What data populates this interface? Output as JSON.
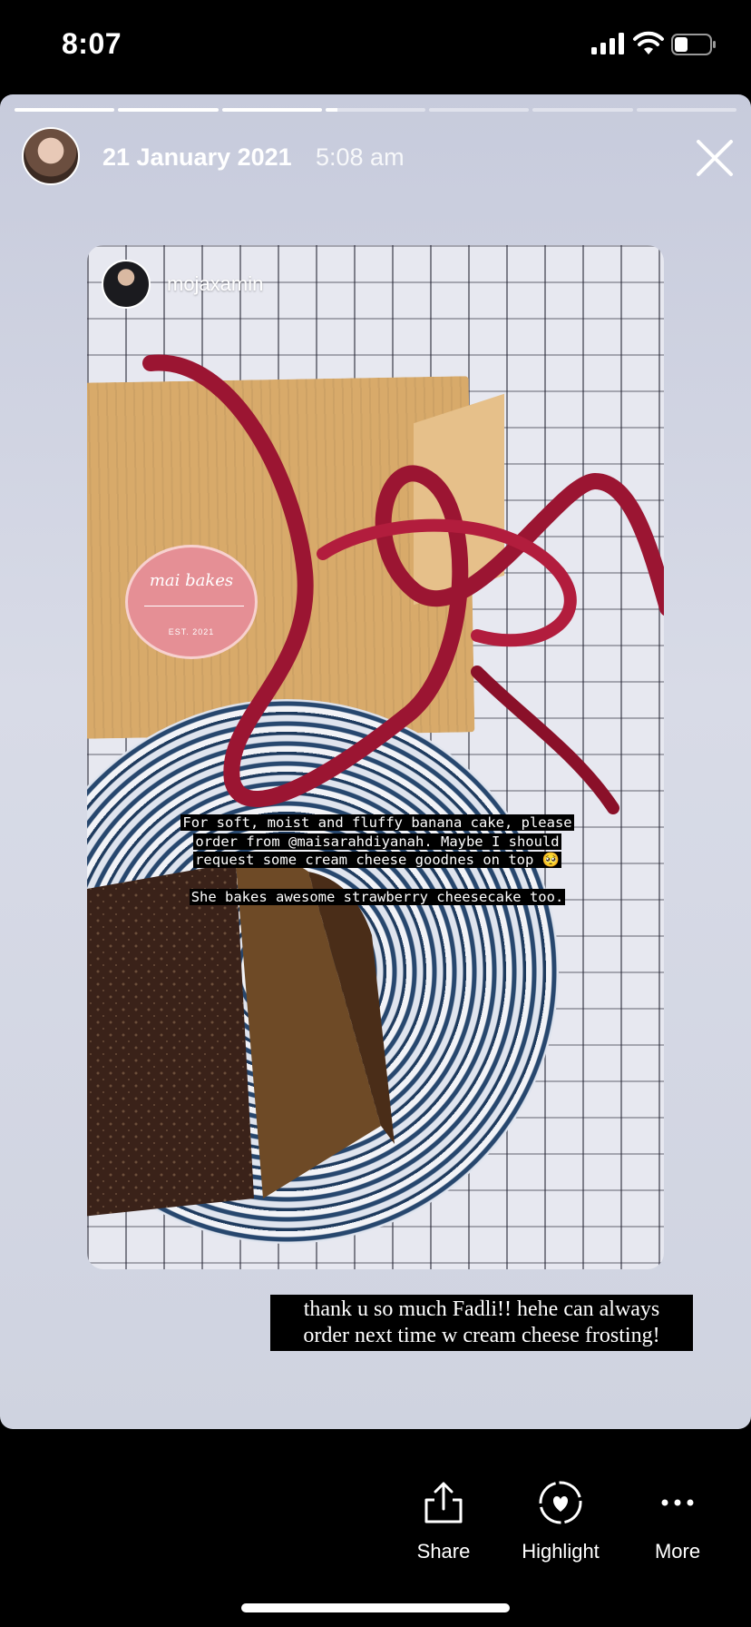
{
  "status_bar": {
    "time": "8:07"
  },
  "story": {
    "progress": [
      1,
      1,
      1,
      0.12,
      0,
      0,
      0
    ],
    "date": "21 January 2021",
    "time": "5:08 am"
  },
  "shared_post": {
    "username": "mojaxamin",
    "sticker": {
      "name": "mai bakes",
      "est": "EST. 2021"
    },
    "caption_lines": [
      "For soft, moist and fluffy banana cake, please",
      "order from @maisarahdiyanah. Maybe I should",
      "request some cream cheese goodnes on top 🥺"
    ],
    "caption_extra": "She bakes awesome strawberry cheesecake too."
  },
  "reply_text": "thank u so much Fadli!! hehe can always order next time w cream cheese frosting!",
  "actions": {
    "share": "Share",
    "highlight": "Highlight",
    "more": "More"
  },
  "colors": {
    "ribbon": "#9b1532",
    "sticker": "#e58f95",
    "plate": "#27476e"
  },
  "icons": [
    "signal-icon",
    "wifi-icon",
    "battery-icon",
    "close-icon",
    "share-icon",
    "highlight-icon",
    "more-icon"
  ]
}
